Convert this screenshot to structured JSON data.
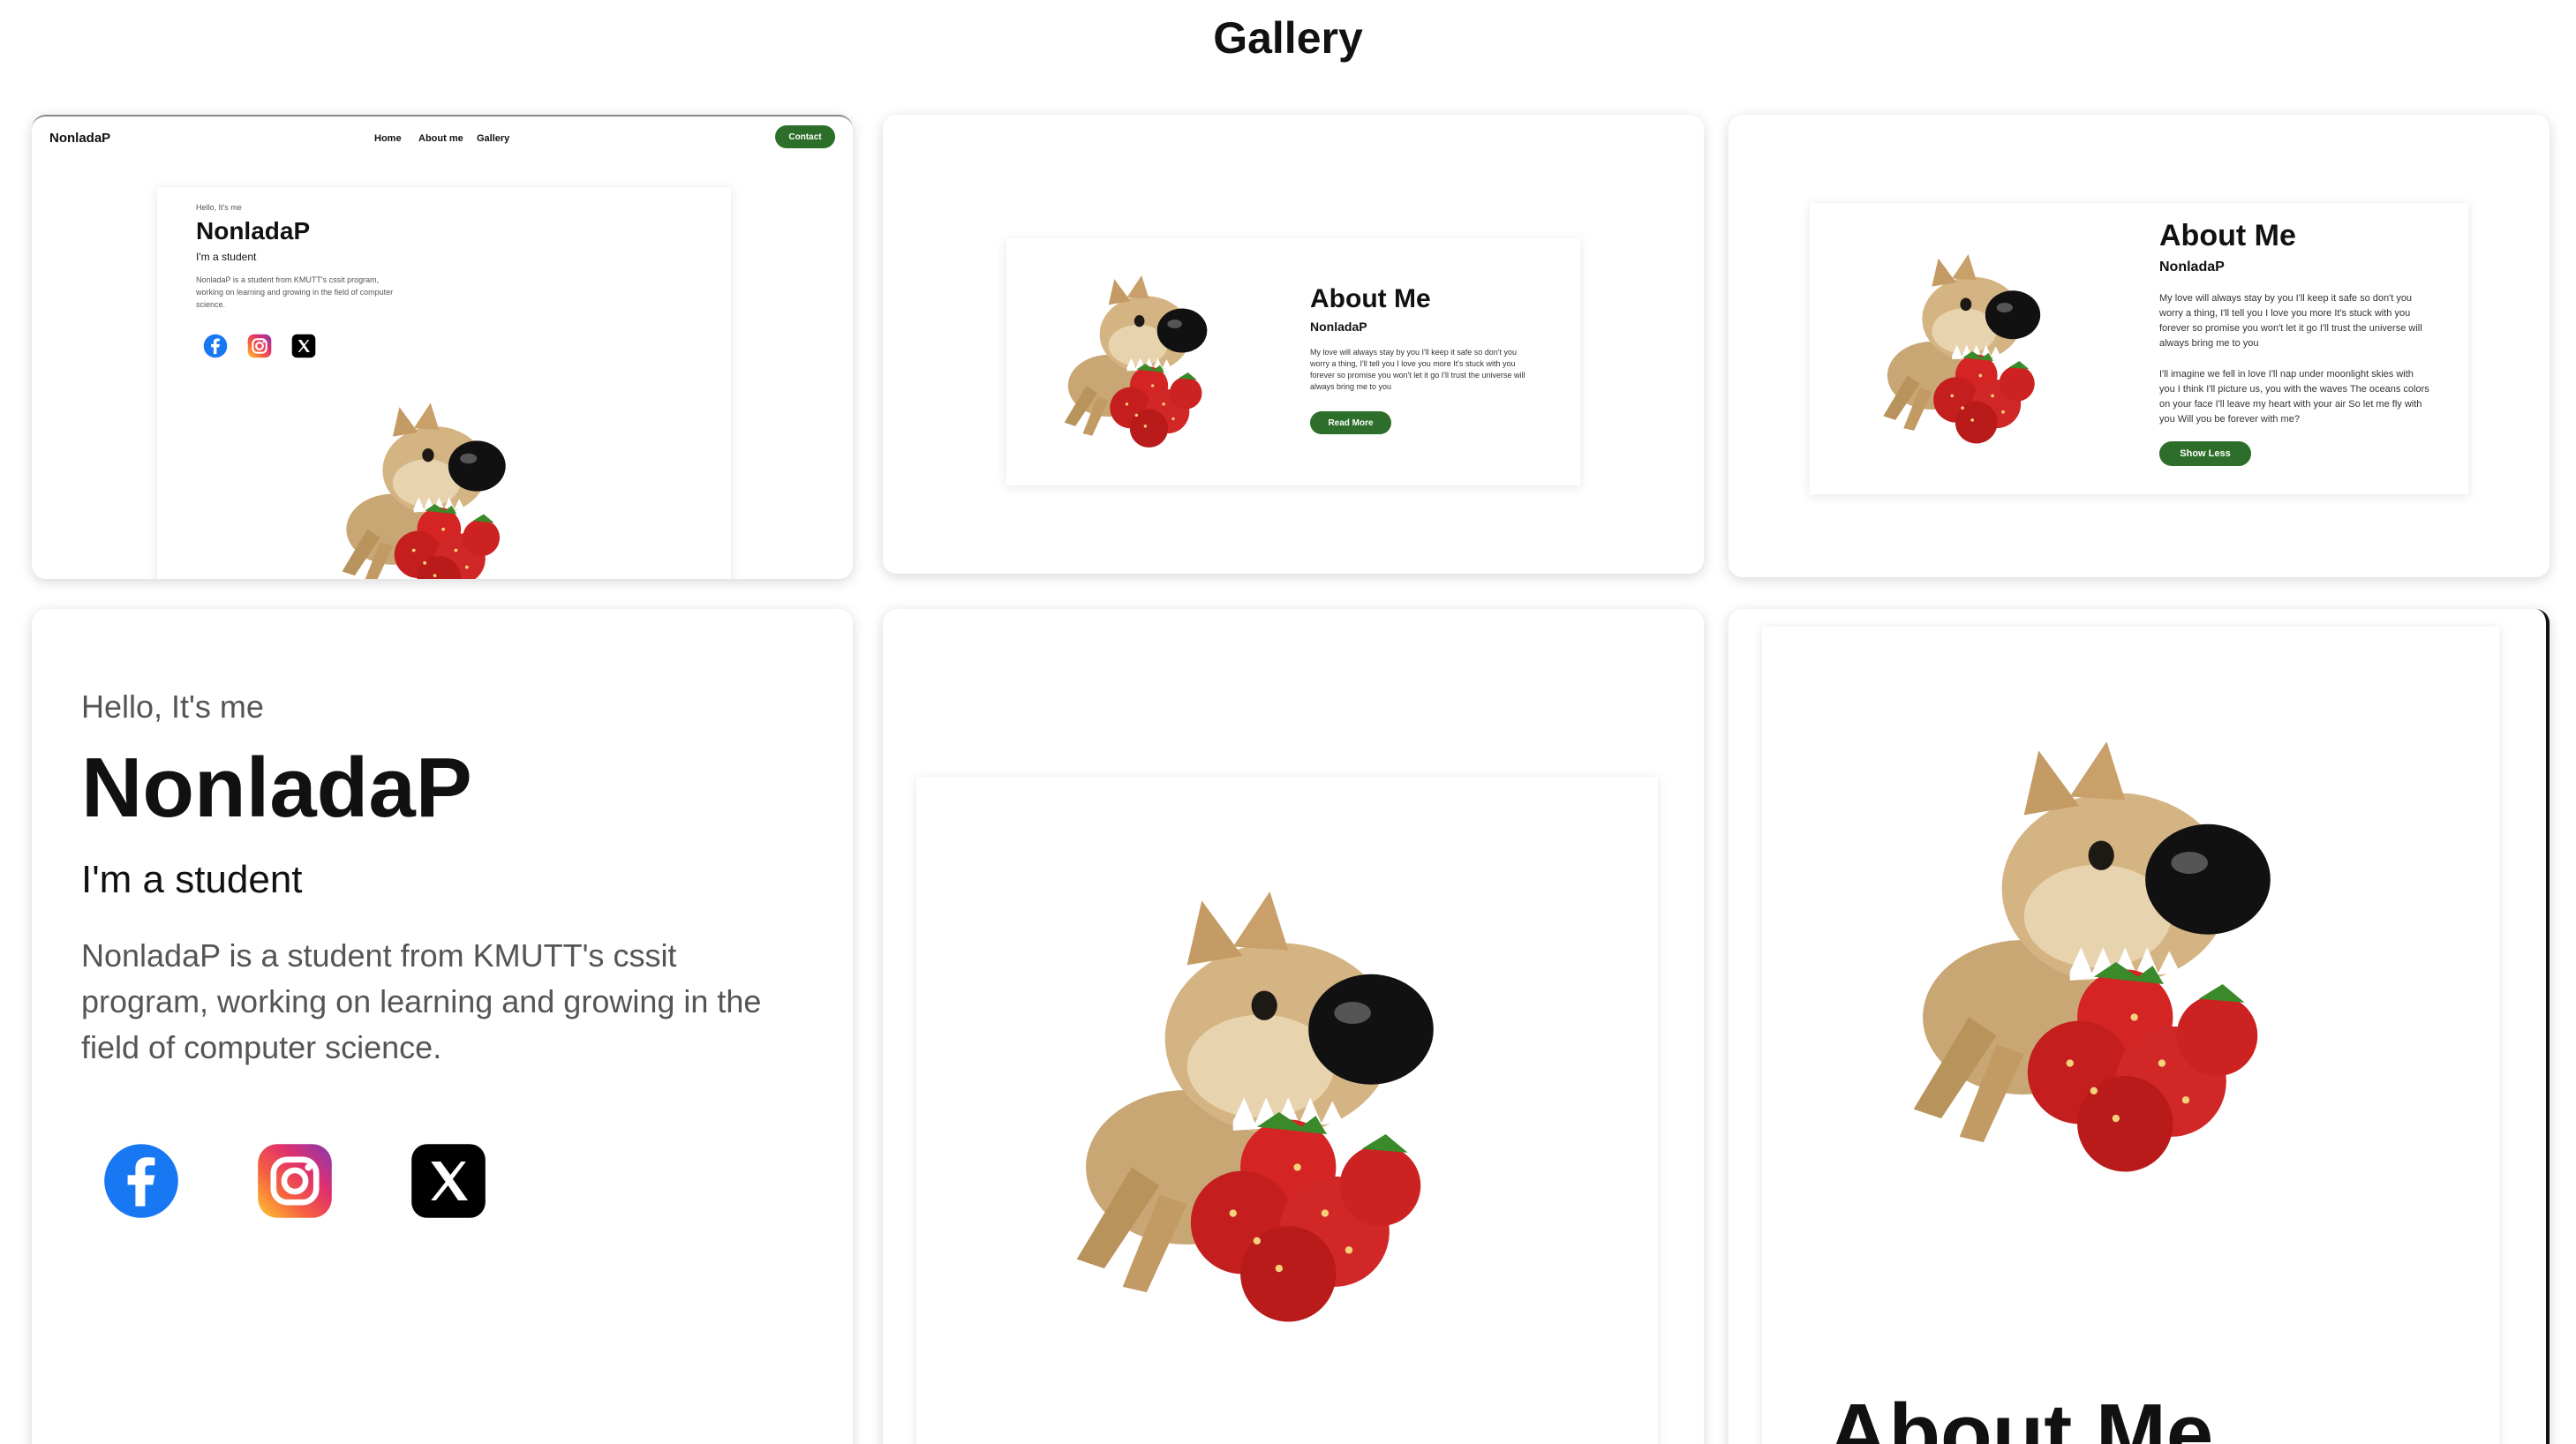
{
  "page": {
    "title": "Gallery"
  },
  "site": {
    "name": "NonladaP",
    "nav": [
      "Home",
      "About me",
      "Gallery"
    ],
    "contact_label": "Contact",
    "greeting": "Hello, It's me",
    "headline": "NonladaP",
    "role": "I'm a student",
    "bio": "NonladaP is a student from KMUTT's cssit program, working on learning and growing in the field of computer science.",
    "bio_lines": [
      "NonladaP is a student from KMUTT's cssit",
      "program, working on learning and growing in the",
      "field of computer science."
    ],
    "bio_lines_small": [
      "NonladaP is a student from KMUTT's cssit program,",
      "working on learning and growing in the field of computer",
      "science."
    ],
    "social": [
      "facebook-icon",
      "instagram-icon",
      "x-icon"
    ]
  },
  "about": {
    "title": "About Me",
    "name": "NonladaP",
    "text_short_lines": [
      "My love will always stay by you I'll keep it safe so don't you",
      "worry a thing, I'll tell you I love you more It's stuck with you",
      "forever so promise you won't let it go I'll trust the universe will",
      "always bring me to you"
    ],
    "text_more_lines": [
      "I'll imagine we fell in love I'll nap under moonlight skies with",
      "you I think I'll picture us, you with the waves The oceans colors",
      "on your face I'll leave my heart with your air So let me fly with",
      "you Will you be forever with me?"
    ],
    "read_more_label": "Read More",
    "show_less_label": "Show Less"
  },
  "colors": {
    "accent": "#2c6e2a",
    "facebook": "#1877f2",
    "x": "#000000"
  }
}
